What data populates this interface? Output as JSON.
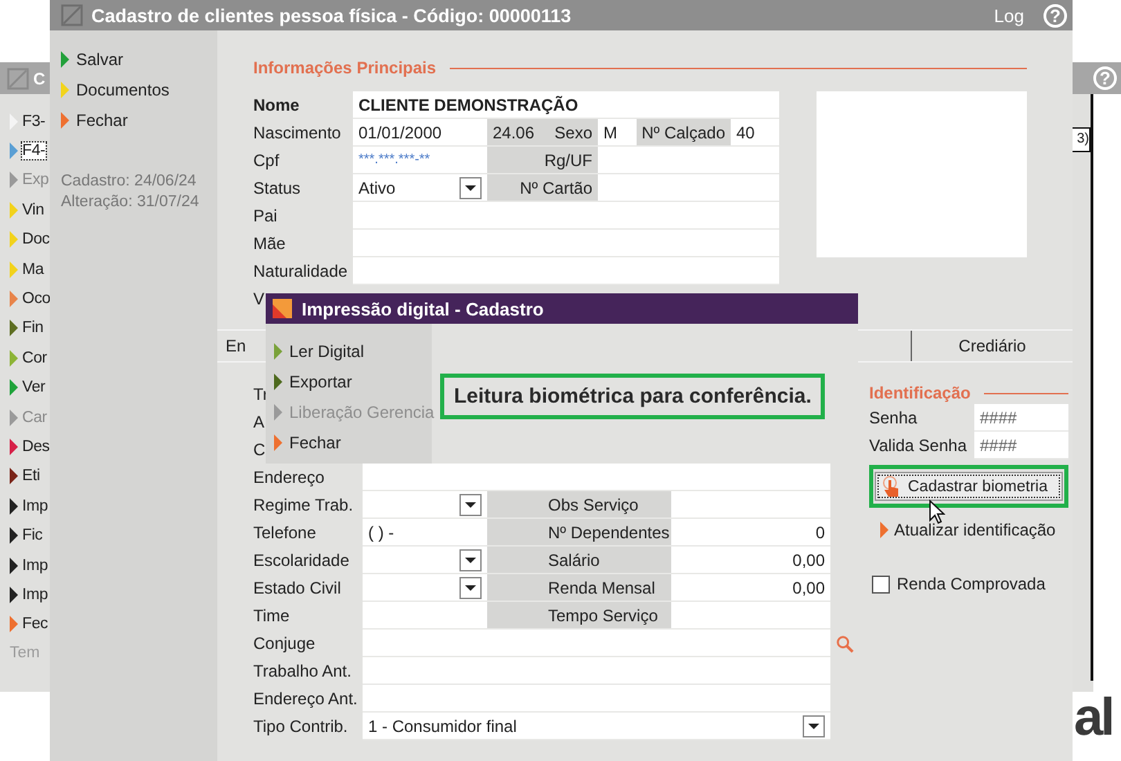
{
  "background_window": {
    "title": "C",
    "help": "?",
    "menu": [
      {
        "label": "F3-",
        "color": "#f4f4f4",
        "disabled": false,
        "focused": false
      },
      {
        "label": "F4-",
        "color": "#5a9fd4",
        "disabled": false,
        "focused": true
      },
      {
        "label": "Exp",
        "color": "#9a9a9a",
        "disabled": true,
        "focused": false
      },
      {
        "label": "Vin",
        "color": "#f2d21c",
        "disabled": false,
        "focused": false
      },
      {
        "label": "Doc",
        "color": "#f2d21c",
        "disabled": false,
        "focused": false
      },
      {
        "label": "Ma",
        "color": "#f2d21c",
        "disabled": false,
        "focused": false
      },
      {
        "label": "Oco",
        "color": "#e8844a",
        "disabled": false,
        "focused": false
      },
      {
        "label": "Fin",
        "color": "#5e6e22",
        "disabled": false,
        "focused": false
      },
      {
        "label": "Cor",
        "color": "#8db436",
        "disabled": false,
        "focused": false
      },
      {
        "label": "Ver",
        "color": "#1fa33a",
        "disabled": false,
        "focused": false
      },
      {
        "label": "Car",
        "color": "#9a9a9a",
        "disabled": true,
        "focused": false
      },
      {
        "label": "Des",
        "color": "#d62048",
        "disabled": false,
        "focused": false
      },
      {
        "label": "Eti",
        "color": "#7a2418",
        "disabled": false,
        "focused": false
      },
      {
        "label": "Imp",
        "color": "#222222",
        "disabled": false,
        "focused": false
      },
      {
        "label": "Fic",
        "color": "#222222",
        "disabled": false,
        "focused": false
      },
      {
        "label": "Imp",
        "color": "#222222",
        "disabled": false,
        "focused": false
      },
      {
        "label": "Imp",
        "color": "#222222",
        "disabled": false,
        "focused": false
      },
      {
        "label": "Fec",
        "color": "#ee7030",
        "disabled": false,
        "focused": false
      }
    ],
    "footer": "Tem",
    "column_3": "3)"
  },
  "desktop_text": "al",
  "main_window": {
    "title": "Cadastro de clientes pessoa física - Código: 00000113",
    "log": "Log",
    "help": "?",
    "actions": [
      {
        "label": "Salvar",
        "color": "#22a03a"
      },
      {
        "label": "Documentos",
        "color": "#f2d41c"
      },
      {
        "label": "Fechar",
        "color": "#ee7030"
      }
    ],
    "created": "Cadastro: 24/06/24",
    "changed": "Alteração: 31/07/24",
    "section_title": "Informações Principais",
    "rows": [
      {
        "label": "Nome",
        "bold": true,
        "cells": [
          {
            "kind": "strong",
            "text": "CLIENTE DEMONSTRAÇÃO"
          }
        ]
      },
      {
        "label": "Nascimento",
        "cells": [
          {
            "kind": "value",
            "text": "01/01/2000"
          },
          {
            "kind": "readonly",
            "text": "24.06"
          },
          {
            "kind": "caption",
            "text": "Sexo"
          },
          {
            "kind": "value",
            "text": "M"
          },
          {
            "kind": "caption",
            "text": "Nº Calçado"
          },
          {
            "kind": "value",
            "text": "40"
          }
        ]
      },
      {
        "label": "Cpf",
        "cells": [
          {
            "kind": "masked",
            "text": "***.***.***-**"
          },
          {
            "kind": "caption",
            "text": "Rg/UF"
          },
          {
            "kind": "blank"
          },
          {
            "kind": "blank"
          }
        ]
      },
      {
        "label": "Status",
        "cells": [
          {
            "kind": "select",
            "text": "Ativo"
          },
          {
            "kind": "caption",
            "text": "Nº Cartão"
          },
          {
            "kind": "blank"
          }
        ]
      },
      {
        "label": "Pai",
        "cells": [
          {
            "kind": "blank"
          }
        ]
      },
      {
        "label": "Mãe",
        "cells": [
          {
            "kind": "blank"
          }
        ]
      },
      {
        "label": "Naturalidade",
        "cells": [
          {
            "kind": "blank"
          }
        ]
      }
    ],
    "partial_row_label": "V",
    "tabs": [
      {
        "label": "En"
      },
      {
        "label": "Crediário"
      }
    ],
    "partial_labels": [
      "Tr",
      "A",
      "C"
    ],
    "lower_rows": [
      {
        "label": "Endereço",
        "cells": [
          {
            "kind": "blank"
          }
        ]
      },
      {
        "label": "Regime Trab.",
        "cells": [
          {
            "kind": "select"
          },
          {
            "kind": "caption",
            "text": "Obs Serviço"
          },
          {
            "kind": "blank"
          }
        ]
      },
      {
        "label": "Telefone",
        "cells": [
          {
            "kind": "value",
            "text": "( )    -"
          },
          {
            "kind": "caption",
            "text": "Nº Dependentes"
          },
          {
            "kind": "number",
            "text": "0"
          }
        ]
      },
      {
        "label": "Escolaridade",
        "cells": [
          {
            "kind": "select"
          },
          {
            "kind": "caption",
            "text": "Salário"
          },
          {
            "kind": "number",
            "text": "0,00"
          }
        ]
      },
      {
        "label": "Estado Civil",
        "cells": [
          {
            "kind": "select"
          },
          {
            "kind": "caption",
            "text": "Renda Mensal"
          },
          {
            "kind": "number",
            "text": "0,00"
          }
        ]
      },
      {
        "label": "Time",
        "cells": [
          {
            "kind": "blank"
          },
          {
            "kind": "caption",
            "text": "Tempo Serviço"
          },
          {
            "kind": "blank"
          }
        ]
      },
      {
        "label": "Conjuge",
        "lookup": true,
        "cells": [
          {
            "kind": "blank"
          }
        ]
      },
      {
        "label": "Trabalho Ant.",
        "cells": [
          {
            "kind": "blank"
          }
        ]
      },
      {
        "label": "Endereço Ant.",
        "cells": [
          {
            "kind": "blank"
          }
        ]
      },
      {
        "label": "Tipo Contrib.",
        "cells": [
          {
            "kind": "select",
            "text": "1 - Consumidor final"
          }
        ]
      }
    ],
    "identification": {
      "title": "Identificação",
      "fields": [
        {
          "label": "Senha",
          "value": "####"
        },
        {
          "label": "Valida Senha",
          "value": "####"
        }
      ],
      "button": {
        "label": "Cadastrar biometria",
        "highlighted": true
      },
      "link": "Atualizar identificação",
      "checkbox": {
        "label": "Renda Comprovada",
        "checked": false
      }
    }
  },
  "dialog": {
    "title": "Impressão digital - Cadastro",
    "actions": [
      {
        "label": "Ler Digital",
        "color": "#7aa23a",
        "disabled": false
      },
      {
        "label": "Exportar",
        "color": "#4e6a1e",
        "disabled": false
      },
      {
        "label": "Liberação Gerencia",
        "color": "#9a9a9a",
        "disabled": true
      },
      {
        "label": "Fechar",
        "color": "#ee7030",
        "disabled": false
      }
    ],
    "message": {
      "text": "Leitura biométrica para conferência.",
      "highlighted": true
    }
  }
}
